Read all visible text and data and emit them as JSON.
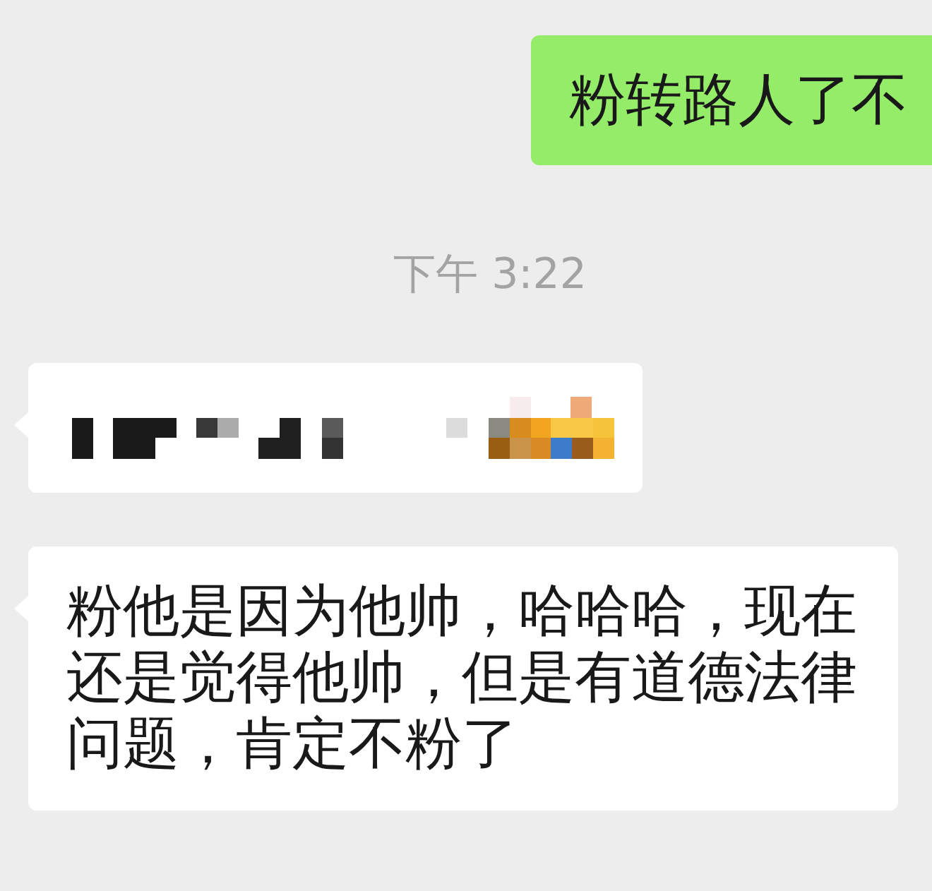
{
  "messages": [
    {
      "kind": "text",
      "outgoing": true,
      "text": "粉转路人了不"
    },
    {
      "kind": "time",
      "text": "下午 3:22"
    },
    {
      "kind": "pixelated",
      "outgoing": false
    },
    {
      "kind": "text",
      "outgoing": false,
      "text": "粉他是因为他帅，哈哈哈，现在还是觉得他帅，但是有道德法律问题，肯定不粉了"
    }
  ]
}
